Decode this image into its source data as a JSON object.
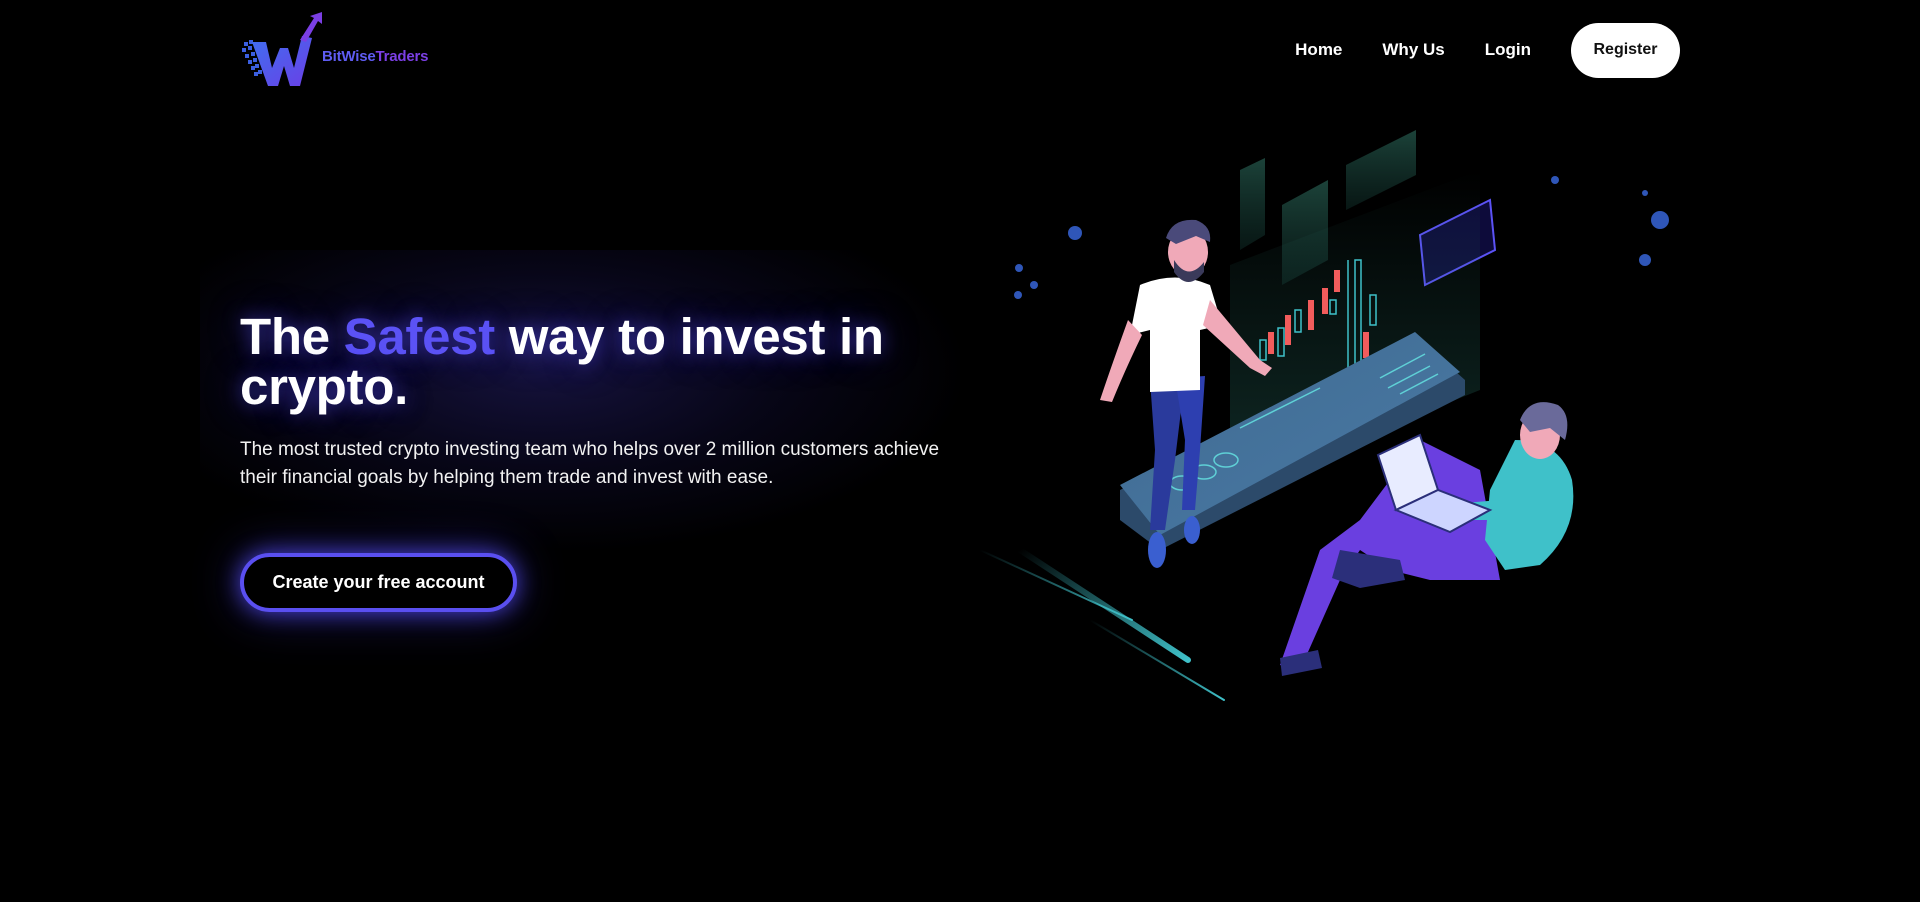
{
  "header": {
    "logo": {
      "brand_part1": "BitWise",
      "brand_part2": "Traders",
      "mark_icon": "bitwise-w-logo-icon"
    },
    "nav": {
      "items": [
        {
          "label": "Home"
        },
        {
          "label": "Why Us"
        },
        {
          "label": "Login"
        }
      ],
      "register_label": "Register"
    }
  },
  "hero": {
    "title_prefix": "The ",
    "title_accent": "Safest",
    "title_suffix": " way to invest in crypto.",
    "subtitle": "The most trusted crypto investing team who helps over 2 million customers achieve their financial goals by helping them trade and invest with ease.",
    "cta_label": "Create your free account"
  },
  "illustration": {
    "icon": "crypto-trading-team-illustration"
  },
  "colors": {
    "background": "#000000",
    "accent": "#5b52f5",
    "logo_purple": "#7b3fe4",
    "teal": "#3fc1c9",
    "candle_red": "#f25c5c"
  }
}
